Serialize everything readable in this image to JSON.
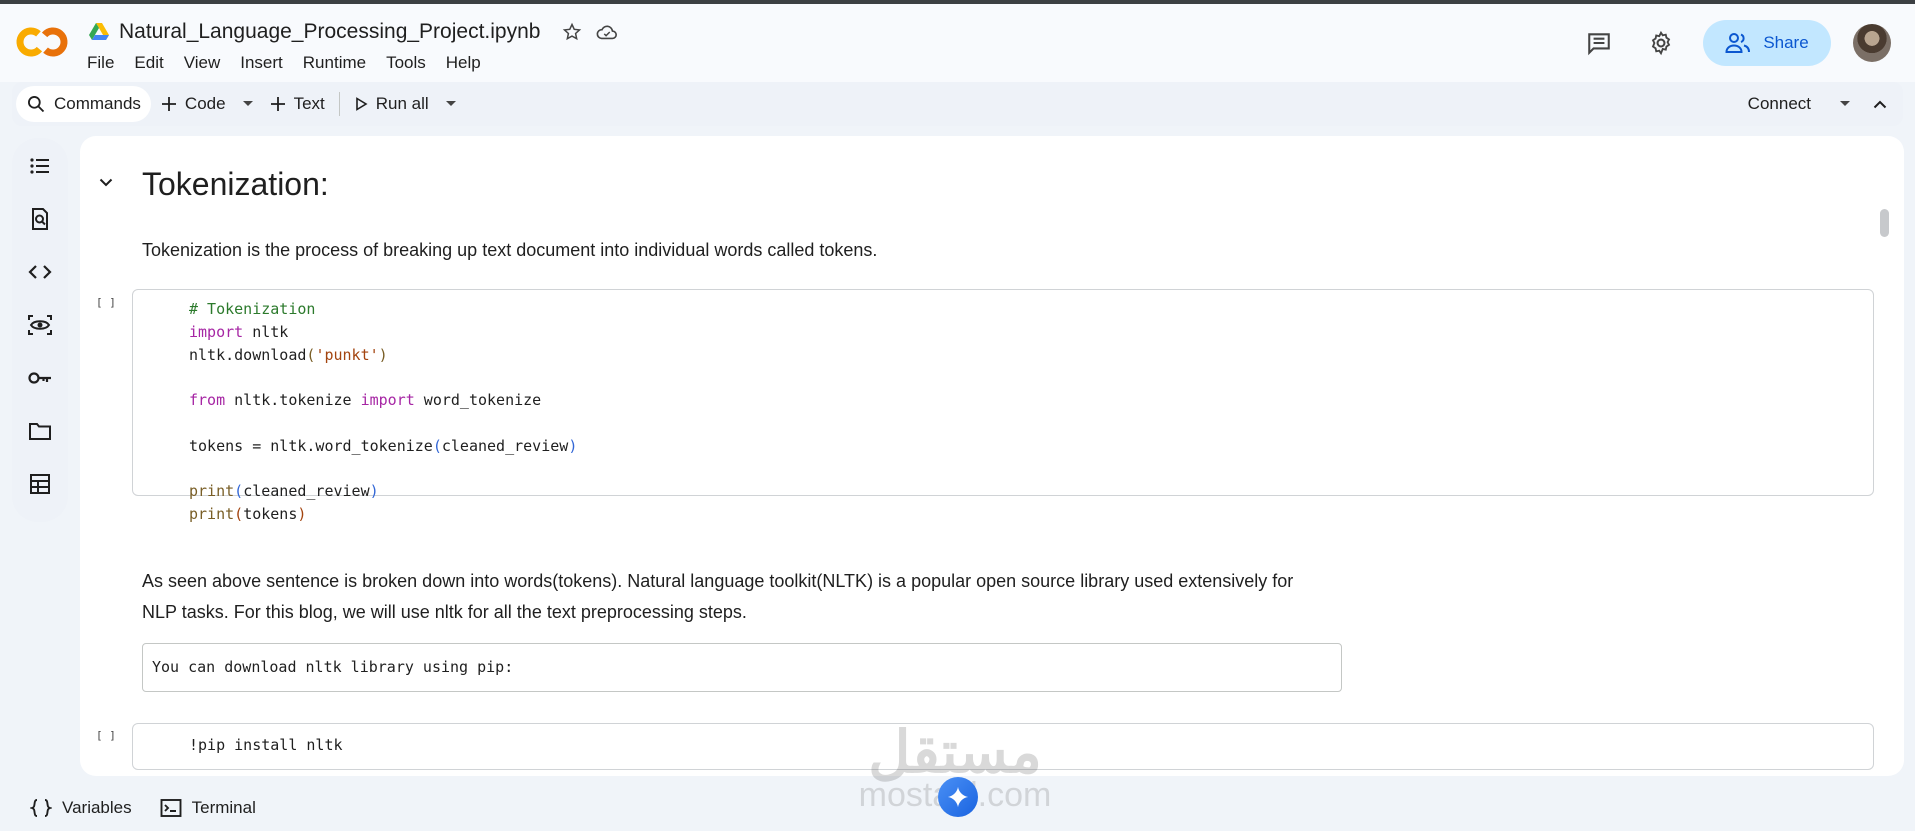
{
  "header": {
    "notebook_title": "Natural_Language_Processing_Project.ipynb",
    "menu": [
      "File",
      "Edit",
      "View",
      "Insert",
      "Runtime",
      "Tools",
      "Help"
    ],
    "share_label": "Share"
  },
  "toolbar": {
    "commands_label": "Commands",
    "code_label": "Code",
    "text_label": "Text",
    "run_all_label": "Run all",
    "connect_label": "Connect"
  },
  "rail": {
    "icons": [
      "table-of-contents-icon",
      "find-replace-icon",
      "code-snippets-icon",
      "variables-inspector-icon",
      "secrets-key-icon",
      "files-folder-icon",
      "data-table-icon"
    ]
  },
  "notebook": {
    "heading": "Tokenization:",
    "intro_text": "Tokenization is the process of breaking up text document into individual words called tokens.",
    "cell1_bracket": "[ ]",
    "cell1_lines": {
      "l1": "# Tokenization",
      "l2_kw": "import",
      "l2_rest": " nltk",
      "l3_a": "nltk.download",
      "l3_b": "(",
      "l3_c": "'punkt'",
      "l3_d": ")",
      "l5_kw1": "from",
      "l5_mid": " nltk.tokenize ",
      "l5_kw2": "import",
      "l5_rest": " word_tokenize",
      "l7_a": "tokens = nltk.word_tokenize",
      "l7_b": "(",
      "l7_c": "cleaned_review",
      "l7_d": ")",
      "l9_a": "print",
      "l9_b": "(",
      "l9_c": "cleaned_review",
      "l9_d": ")",
      "l10_a": "print",
      "l10_b": "(",
      "l10_c": "tokens",
      "l10_d": ")"
    },
    "paragraph2": "As seen above sentence is broken down into words(tokens). Natural language toolkit(NLTK) is a popular open source library used extensively for NLP tasks. For this blog, we will use nltk for all the text preprocessing steps.",
    "mono_text": "You can download nltk library using pip:",
    "cell2_bracket": "[ ]",
    "cell2_code": "!pip install nltk"
  },
  "statusbar": {
    "variables_label": "Variables",
    "terminal_label": "Terminal"
  },
  "watermark": {
    "arabic": "مستقل",
    "latin": "mostaql.com"
  },
  "colors": {
    "share_bg": "#c2e7ff",
    "accent_blue": "#0b57d0",
    "keyword": "#a626a4",
    "comment": "#2c7a2c",
    "string": "#a3440f"
  }
}
